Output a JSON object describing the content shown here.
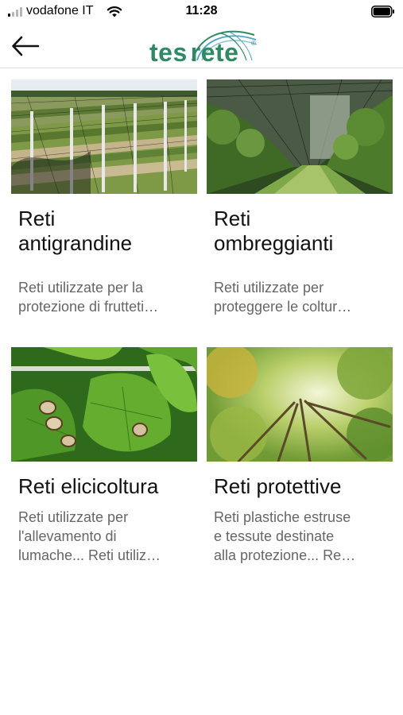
{
  "status_bar": {
    "carrier": "vodafone IT",
    "time": "11:28"
  },
  "header": {
    "back_icon": "arrow-left-icon",
    "logo_text_left": "tes",
    "logo_text_right": "rete",
    "logo_mark": "®",
    "brand_color": "#2e8a63"
  },
  "cards": [
    {
      "title": "Reti\nantigrandine",
      "description": "Reti utilizzate per la\nprotezione di frutteti…",
      "image": "hail-net-orchard"
    },
    {
      "title": "Reti\nombreggianti",
      "description": "Reti utilizzate per\nproteggere le coltur…",
      "image": "shade-net-orchard"
    },
    {
      "title": "Reti  elicicoltura",
      "description": "Reti utilizzate per\nl'allevamento di\nlumache... Reti utiliz…",
      "image": "snails-on-leaves"
    },
    {
      "title": "Reti protettive",
      "description": "Reti plastiche estruse\ne tessute destinate\nalla protezione... Re…",
      "image": "forest-canopy"
    }
  ]
}
